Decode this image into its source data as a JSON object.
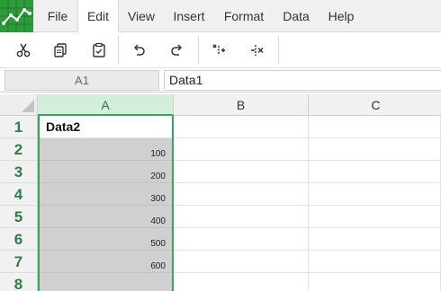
{
  "menu": {
    "items": [
      "File",
      "Edit",
      "View",
      "Insert",
      "Format",
      "Data",
      "Help"
    ],
    "active": "Edit"
  },
  "toolbar": {
    "buttons": [
      "scissors-icon",
      "copy-icon",
      "paste-icon",
      "undo-icon",
      "redo-icon",
      "insert-column-icon",
      "delete-column-icon"
    ]
  },
  "formula_bar": {
    "cell_reference": "A1",
    "value": "Data1"
  },
  "grid": {
    "columns": [
      "A",
      "B",
      "C"
    ],
    "selected_column": "A",
    "rows": [
      "1",
      "2",
      "3",
      "4",
      "5",
      "6",
      "7",
      "8"
    ],
    "column_a_values": [
      "Data2",
      "100",
      "200",
      "300",
      "400",
      "500",
      "600",
      ""
    ]
  },
  "colors": {
    "accent": "#34a853",
    "logo_bg": "#2e9b3b",
    "selection_fill": "#d0d0d0",
    "header_selected": "#d3efdc"
  }
}
